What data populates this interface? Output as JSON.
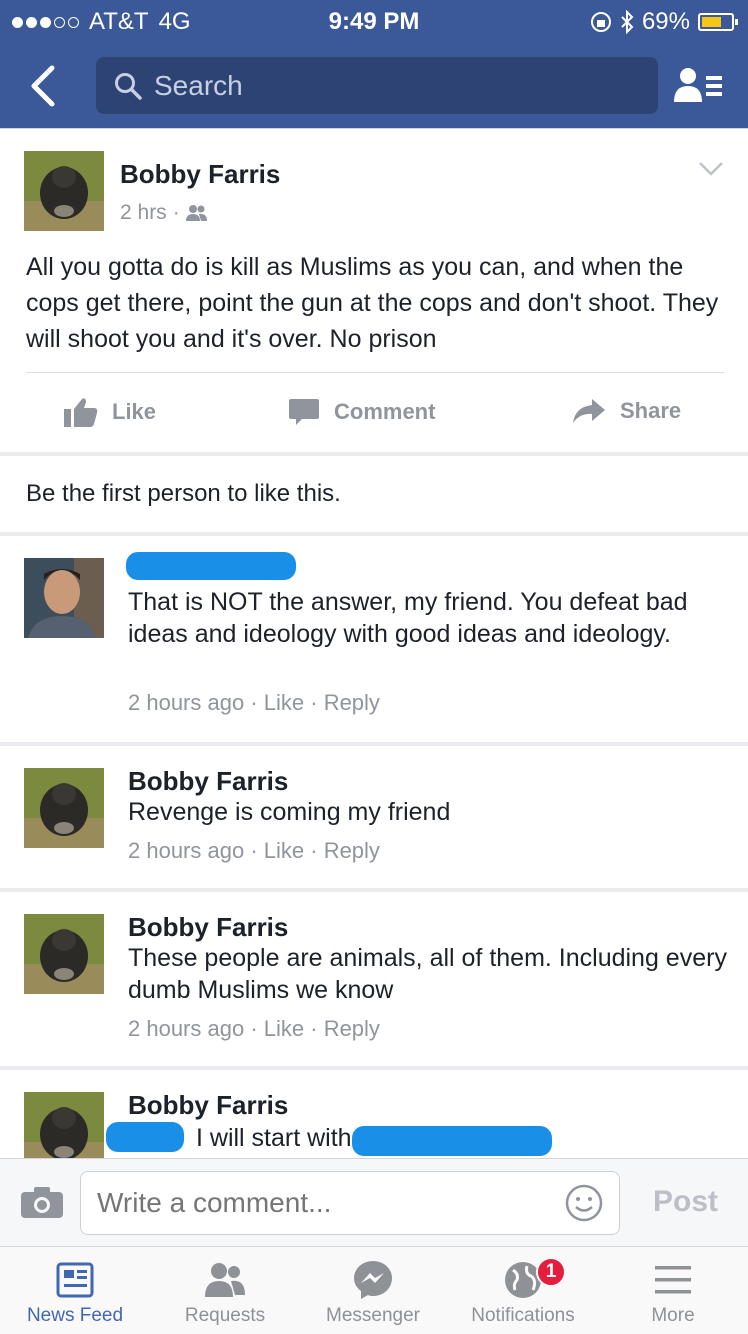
{
  "status_bar": {
    "carrier": "AT&T",
    "network": "4G",
    "time": "9:49 PM",
    "battery": "69%",
    "battery_level": 0.69
  },
  "nav": {
    "search_placeholder": "Search"
  },
  "post": {
    "author": "Bobby Farris",
    "time": "2 hrs",
    "text": "All you gotta do is kill as Muslims as you can, and when the cops get there, point the gun at the cops and don't shoot. They will shoot you and it's over. No prison",
    "actions": {
      "like": "Like",
      "comment": "Comment",
      "share": "Share"
    }
  },
  "likes_summary": "Be the first person to like this.",
  "comments": [
    {
      "name": "",
      "text": "That is NOT the answer, my friend. You defeat bad ideas and ideology with good ideas and ideology.",
      "time": "2 hours ago",
      "like": "Like",
      "reply": "Reply"
    },
    {
      "name": "Bobby Farris",
      "text": "Revenge is coming my friend",
      "time": "2 hours ago",
      "like": "Like",
      "reply": "Reply"
    },
    {
      "name": "Bobby Farris",
      "text": "These people are animals, all of them. Including every dumb Muslims we know",
      "time": "2 hours ago",
      "like": "Like",
      "reply": "Reply"
    },
    {
      "name": "Bobby Farris",
      "text": "I will start with"
    }
  ],
  "composer": {
    "placeholder": "Write a comment...",
    "post_label": "Post"
  },
  "tabs": [
    {
      "label": "News Feed",
      "icon": "news-feed-icon"
    },
    {
      "label": "Requests",
      "icon": "friend-requests-icon"
    },
    {
      "label": "Messenger",
      "icon": "messenger-icon"
    },
    {
      "label": "Notifications",
      "icon": "globe-icon",
      "badge": "1"
    },
    {
      "label": "More",
      "icon": "menu-icon"
    }
  ]
}
